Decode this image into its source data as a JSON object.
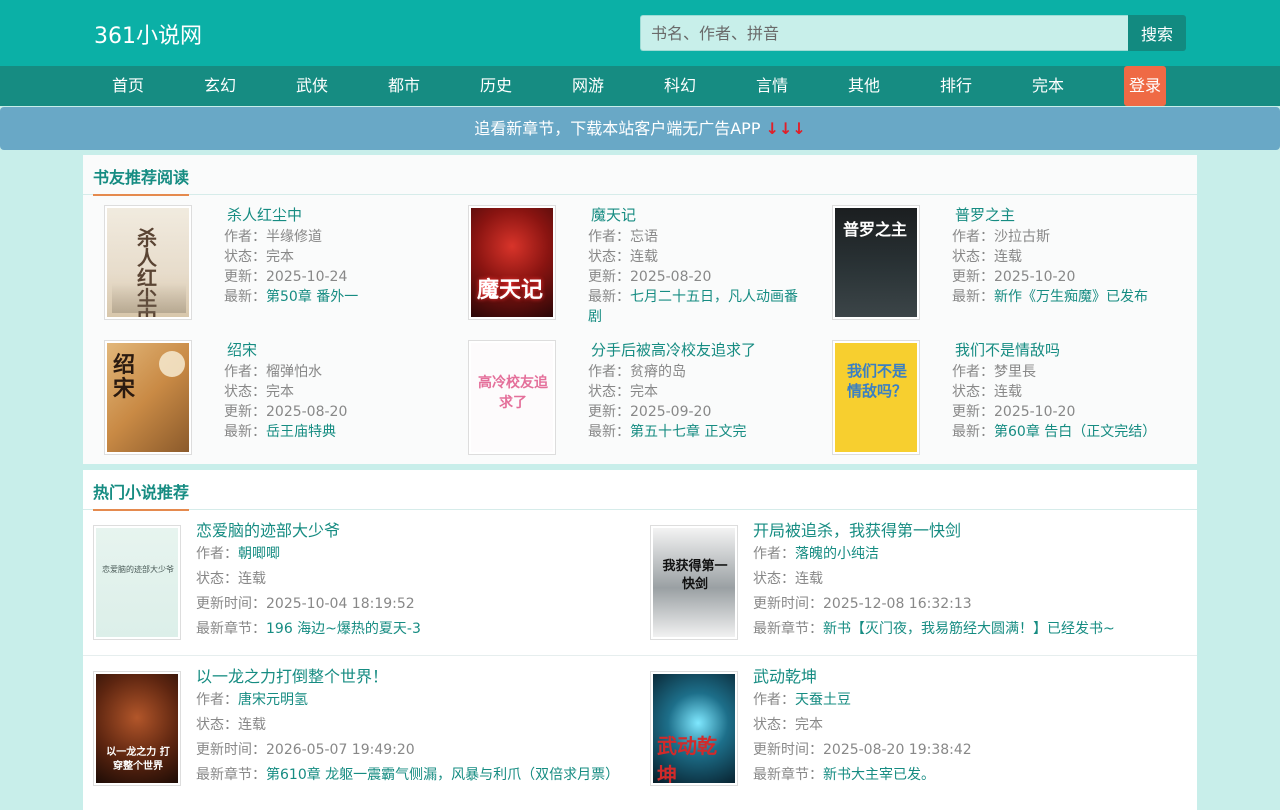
{
  "site": {
    "logo": "361小说网"
  },
  "search": {
    "placeholder": "书名、作者、拼音",
    "button": "搜索"
  },
  "nav": {
    "items": [
      "首页",
      "玄幻",
      "武侠",
      "都市",
      "历史",
      "网游",
      "科幻",
      "言情",
      "其他",
      "排行",
      "完本"
    ],
    "login": "登录"
  },
  "banner": {
    "text": "追看新章节，下载本站客户端无广告APP ",
    "arrows": "↓↓↓"
  },
  "labels": {
    "author": "作者：",
    "status": "状态：",
    "updated": "更新：",
    "latest": "最新：",
    "updated_time": "更新时间：",
    "latest_chapter": "最新章节："
  },
  "recommend": {
    "title": "书友推荐阅读",
    "books": [
      {
        "title": "杀人红尘中",
        "author": "半缘修道",
        "status": "完本",
        "updated": "2025-10-24",
        "latest": "第50章 番外一",
        "cover_text": "杀人红尘中"
      },
      {
        "title": "魔天记",
        "author": "忘语",
        "status": "连载",
        "updated": "2025-08-20",
        "latest": "七月二十五日，凡人动画番剧",
        "cover_text": "魔天记"
      },
      {
        "title": "普罗之主",
        "author": "沙拉古斯",
        "status": "连载",
        "updated": "2025-10-20",
        "latest": "新作《万生痴魔》已发布",
        "cover_text": "普罗之主"
      },
      {
        "title": "绍宋",
        "author": "榴弹怕水",
        "status": "完本",
        "updated": "2025-08-20",
        "latest": "岳王庙特典",
        "cover_text": "绍宋"
      },
      {
        "title": "分手后被高冷校友追求了",
        "author": "贫瘠的岛",
        "status": "完本",
        "updated": "2025-09-20",
        "latest": "第五十七章 正文完",
        "cover_text": "高冷校友追求了"
      },
      {
        "title": "我们不是情敌吗",
        "author": "梦里長",
        "status": "连载",
        "updated": "2025-10-20",
        "latest": "第60章 告白（正文完结）",
        "cover_text": "我们不是情敌吗？"
      }
    ]
  },
  "hot": {
    "title": "热门小说推荐",
    "books": [
      {
        "title": "恋爱脑的迹部大少爷",
        "author": "朝唧唧",
        "status": "连载",
        "updated": "2025-10-04 18:19:52",
        "latest": "196 海边~爆热的夏天-3",
        "cover_text": "恋爱脑的迹部大少爷"
      },
      {
        "title": "开局被追杀，我获得第一快剑",
        "author": "落魄的小纯洁",
        "status": "连载",
        "updated": "2025-12-08 16:32:13",
        "latest": "新书【灭门夜，我易筋经大圆满！】已经发书~",
        "cover_text": "我获得第一快剑"
      },
      {
        "title": "以一龙之力打倒整个世界！",
        "author": "唐宋元明氢",
        "status": "连载",
        "updated": "2026-05-07 19:49:20",
        "latest": "第610章 龙躯一震霸气侧漏，风暴与利爪（双倍求月票）",
        "cover_text": "以一龙之力 打穿整个世界"
      },
      {
        "title": "武动乾坤",
        "author": "天蚕土豆",
        "status": "完本",
        "updated": "2025-08-20 19:38:42",
        "latest": "新书大主宰已发。",
        "cover_text": "武动乾坤"
      }
    ]
  }
}
